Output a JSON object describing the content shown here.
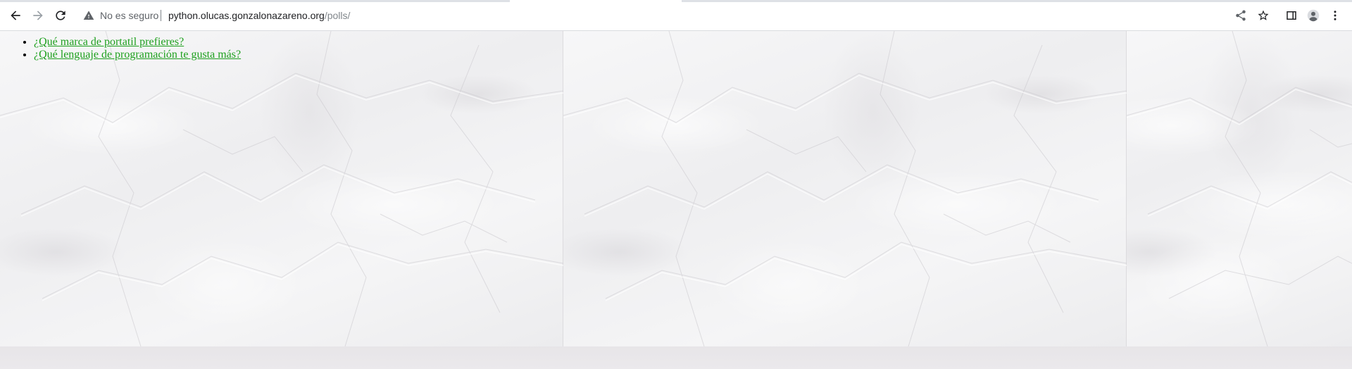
{
  "browser": {
    "security_label": "No es seguro",
    "url_host": "python.olucas.gonzalonazareno.org",
    "url_path": "/polls/",
    "icons": {
      "back": "arrow-back-icon",
      "forward": "arrow-forward-icon",
      "reload": "reload-icon",
      "security": "warning-triangle-icon",
      "share": "share-icon",
      "bookmark": "star-icon",
      "side_panel": "side-panel-icon",
      "profile": "profile-icon",
      "menu": "kebab-menu-icon"
    }
  },
  "page": {
    "background": "crumpled-paper",
    "link_color": "#1ea01e",
    "polls": [
      {
        "question": "¿Qué marca de portatil prefieres?"
      },
      {
        "question": "¿Qué lenguaje de programación te gusta más?"
      }
    ]
  }
}
